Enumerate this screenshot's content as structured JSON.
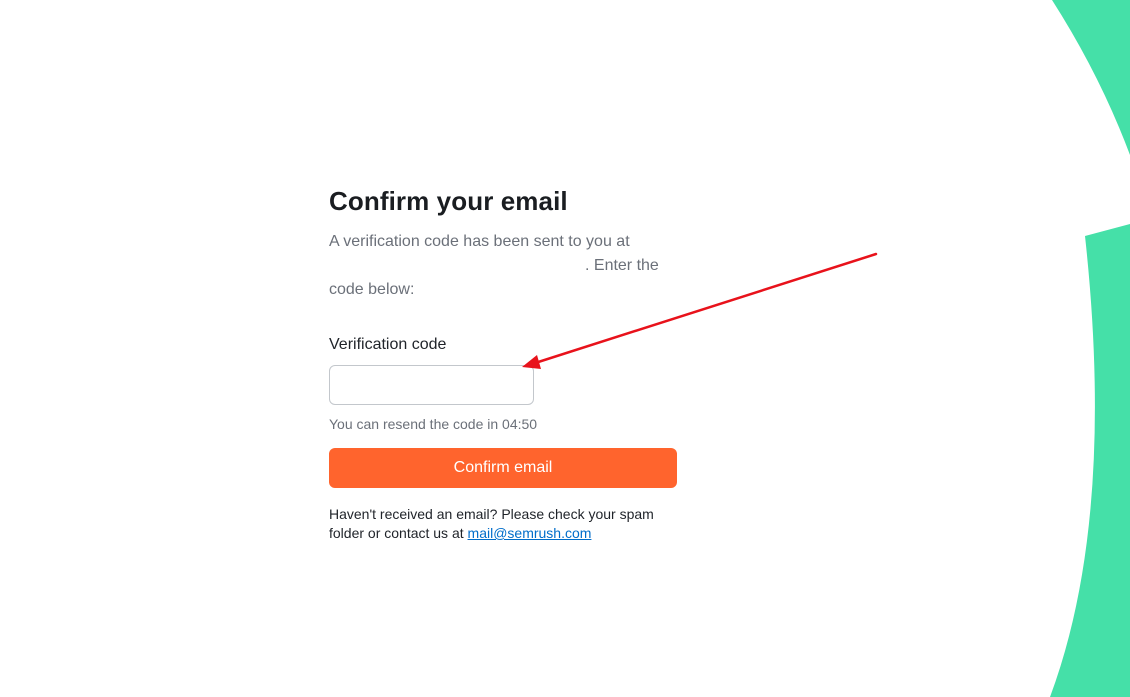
{
  "page": {
    "title": "Confirm your email",
    "intro_line1": "A verification code has been sent to you at",
    "intro_line2_suffix": ". Enter the code below:"
  },
  "form": {
    "code_label": "Verification code",
    "code_value": "",
    "resend_text": "You can resend the code in 04:50",
    "confirm_label": "Confirm email"
  },
  "help": {
    "text": "Haven't received an email? Please check your spam folder or contact us at",
    "link_text": "mail@semrush.com"
  },
  "colors": {
    "accent_orange": "#ff642d",
    "brand_green": "#45e0a8",
    "link_blue": "#006dca",
    "annotation_red": "#e8121b"
  },
  "icons": {
    "decoration": "green-arc-shapes",
    "annotation": "red-arrow"
  }
}
